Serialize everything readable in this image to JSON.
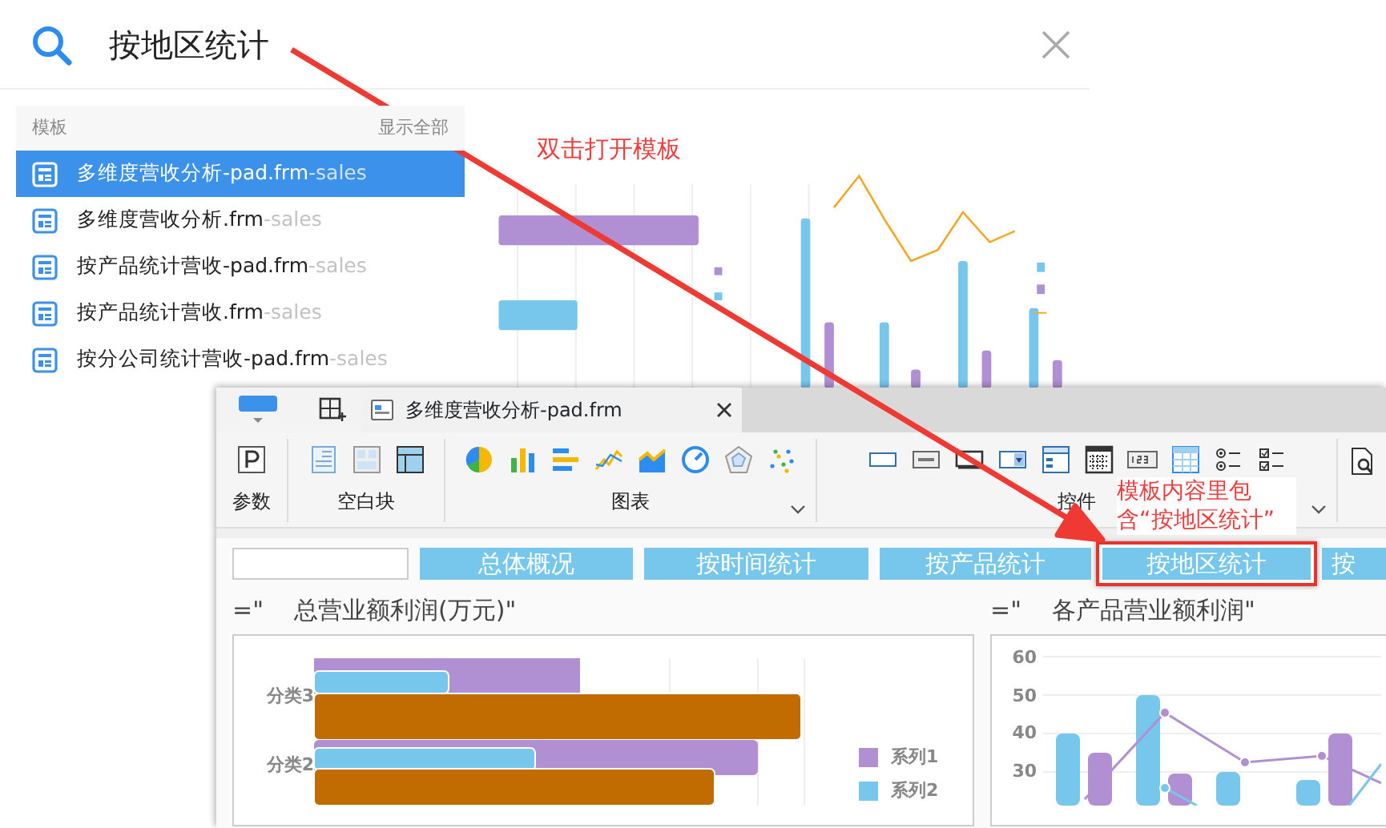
{
  "search": {
    "query": "按地区统计"
  },
  "results": {
    "header": "模板",
    "show_all": "显示全部",
    "items": [
      {
        "name": "多维度营收分析-pad.frm",
        "source": "-sales",
        "selected": true
      },
      {
        "name": "多维度营收分析.frm",
        "source": "-sales",
        "selected": false
      },
      {
        "name": "按产品统计营收-pad.frm",
        "source": "-sales",
        "selected": false
      },
      {
        "name": "按产品统计营收.frm",
        "source": "-sales",
        "selected": false
      },
      {
        "name": "按分公司统计营收-pad.frm",
        "source": "-sales",
        "selected": false
      }
    ]
  },
  "preview": {
    "hint": "双击打开模板"
  },
  "designer": {
    "tab": {
      "title": "多维度营收分析-pad.frm"
    },
    "toolbar_groups": [
      {
        "label": "参数",
        "expandable": false
      },
      {
        "label": "空白块",
        "expandable": false
      },
      {
        "label": "图表",
        "expandable": true
      },
      {
        "label": "控件",
        "expandable": true
      }
    ],
    "nav_buttons": [
      {
        "label": "总体概况",
        "highlighted": false
      },
      {
        "label": "按时间统计",
        "highlighted": false
      },
      {
        "label": "按产品统计",
        "highlighted": false
      },
      {
        "label": "按地区统计",
        "highlighted": true
      },
      {
        "label": "按",
        "highlighted": false
      }
    ],
    "charts": [
      {
        "title": "=\"    总营业额利润(万元)\"",
        "categories": [
          "分类3",
          "分类2"
        ],
        "legend": [
          "系列1",
          "系列2"
        ]
      },
      {
        "title": "=\"    各产品营业额利润\"",
        "y_labels": [
          "60",
          "50",
          "40",
          "30"
        ]
      }
    ]
  },
  "callout": "模板内容里包含“按地区统计”"
}
